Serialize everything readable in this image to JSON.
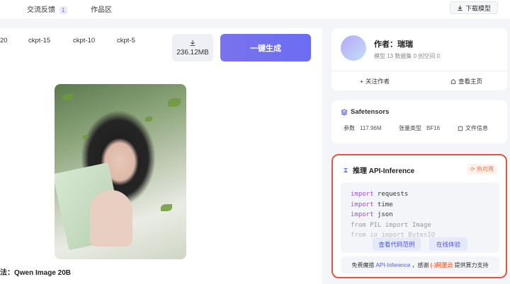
{
  "topbar": {
    "tabs": [
      {
        "label": "交流反馈",
        "count": "1"
      },
      {
        "label": "作品区"
      }
    ],
    "download_label": "下载模型"
  },
  "left": {
    "ckpt_items": [
      "20",
      "ckpt-15",
      "ckpt-10",
      "ckpt-5"
    ],
    "size_label": "236.12MB",
    "generate_label": "一键生成",
    "caption": "法：Qwen Image 20B"
  },
  "author": {
    "name": "作者：瑞瑞",
    "stats": "模型 13 数据集 0 创空间 0",
    "follow_label": "关注作者",
    "home_label": "查看主页"
  },
  "safetensors": {
    "title": "Safetensors",
    "params_label": "参数",
    "params_value": "117.96M",
    "dtype_label": "张量类型",
    "dtype_value": "BF16",
    "fileinfo_label": "文件信息"
  },
  "api": {
    "title": "推理 API-Inference",
    "badge": "热可用",
    "code": {
      "l1_kw": "import",
      "l1_rest": " requests",
      "l2_kw": "import",
      "l2_rest": " time",
      "l3_kw": "import",
      "l3_rest": " json",
      "l4": "from PIL import Image",
      "l5": "from io import BytesIO"
    },
    "view_code_label": "查看代码范例",
    "online_label": "在线体验",
    "foot_prefix": "免费魔搭",
    "foot_link": "API-Inference",
    "foot_mid": "，感谢",
    "foot_brand": "(-)阿里云",
    "foot_suffix": "提供算力支持"
  }
}
